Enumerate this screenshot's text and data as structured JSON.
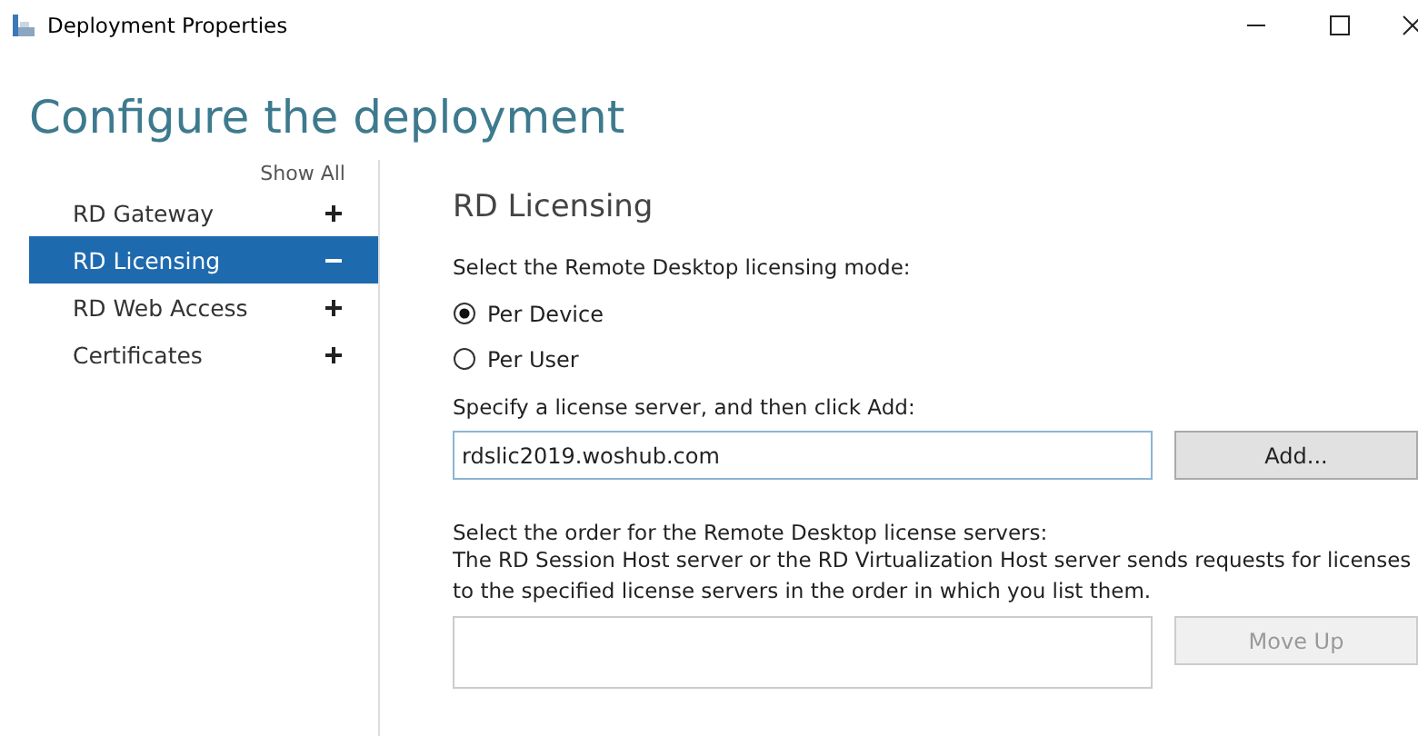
{
  "window": {
    "title": "Deployment Properties"
  },
  "heading": "Configure the deployment",
  "sidebar": {
    "show_all": "Show All",
    "items": [
      {
        "label": "RD Gateway",
        "selected": false,
        "expanded": false
      },
      {
        "label": "RD Licensing",
        "selected": true,
        "expanded": true
      },
      {
        "label": "RD Web Access",
        "selected": false,
        "expanded": false
      },
      {
        "label": "Certificates",
        "selected": false,
        "expanded": false
      }
    ]
  },
  "panel": {
    "title": "RD Licensing",
    "mode_label": "Select the Remote Desktop licensing mode:",
    "modes": [
      {
        "label": "Per Device",
        "selected": true
      },
      {
        "label": "Per User",
        "selected": false
      }
    ],
    "server_label": "Specify a license server, and then click Add:",
    "server_field": {
      "value": "rdslic2019.woshub.com"
    },
    "add_button": {
      "label": "Add...",
      "disabled": false
    },
    "order_label": "Select the order for the Remote Desktop license servers:",
    "order_description": "The RD Session Host server or the RD Virtualization Host server sends requests for licenses to the specified license servers in the order in which you list them.",
    "move_up_button": {
      "label": "Move Up",
      "disabled": true
    }
  }
}
